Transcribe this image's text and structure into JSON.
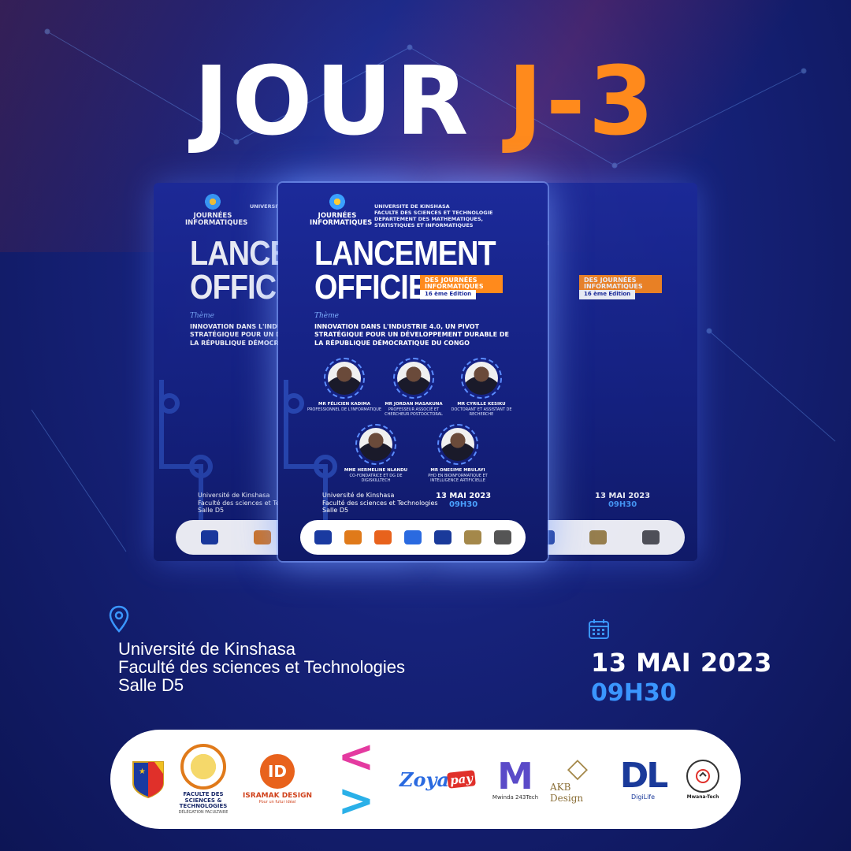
{
  "headline": {
    "word1": "JOUR",
    "word2": "J-3"
  },
  "poster": {
    "logo_text": "JOURNÉES INFORMATIQUES",
    "institution": [
      "UNIVERSITE DE KINSHASA",
      "FACULTE DES SCIENCES ET TECHNOLOGIE",
      "DEPARTEMENT DES MATHEMATIQUES,",
      "STATISTIQUES ET INFORMATIQUES"
    ],
    "title_line1": "LANCEMENT",
    "title_line2": "OFFICIEL",
    "badge": "DES JOURNÉES INFORMATIQUES",
    "edition": "16 ème Edition",
    "theme_label": "Thème",
    "theme": "INNOVATION DANS L'INDUSTRIE 4.0, UN PIVOT STRATÉGIQUE POUR UN DÉVELOPPEMENT DURABLE DE LA RÉPUBLIQUE DÉMOCRATIQUE DU CONGO",
    "speakers": [
      {
        "name": "Mr FÉLICIEN KADIMA",
        "role": "PROFESSIONNEL DE L'INFORMATIQUE"
      },
      {
        "name": "Mr JORDAN MASAKUNA",
        "role": "PROFESSEUR ASSOCIÉ ET CHERCHEUR POSTDOCTORAL"
      },
      {
        "name": "Mr CYRILLE KESIKU",
        "role": "DOCTORANT ET ASSISTANT DE RECHERCHE"
      },
      {
        "name": "Mme HERMELINE NLANDU",
        "role": "CO-FONDATRICE ET DG DE DIGISKILLTECH"
      },
      {
        "name": "Mr ONESIME MBULAYI",
        "role": "PHD EN BIOINFORMATIQUE ET INTELLIGENCE ARTIFICIELLE"
      }
    ],
    "venue": [
      "Université de Kinshasa",
      "Faculté des sciences et Technologies",
      "Salle D5"
    ],
    "date": "13 MAI 2023",
    "time": "09H30"
  },
  "venue": {
    "icon": "location-pin-icon",
    "line1": "Université de Kinshasa",
    "line2": "Faculté des sciences et Technologies",
    "line3": "Salle D5"
  },
  "event": {
    "icon": "calendar-icon",
    "date": "13 MAI 2023",
    "time": "09H30"
  },
  "sponsors": {
    "fst_name": "FACULTE DES SCIENCES & TECHNOLOGIES",
    "fst_sub": "DÉLÉGATION FACULTAIRE",
    "isramak_name": "ISRAMAK DESIGN",
    "isramak_tagline": "Pour un futur idéal",
    "isramak_mark": "ID",
    "zoya": "Zoya",
    "zoya_pay": "pay",
    "mwinda_name": "Mwinda 243Tech",
    "akb_name": "AKB Design",
    "dl_mark": "DL",
    "dl_name": "DigiLife",
    "mwana_name": "Mwana-Tech"
  },
  "colors": {
    "accent": "#ff8a1c",
    "time": "#3a96ff",
    "background": "#16227a"
  }
}
